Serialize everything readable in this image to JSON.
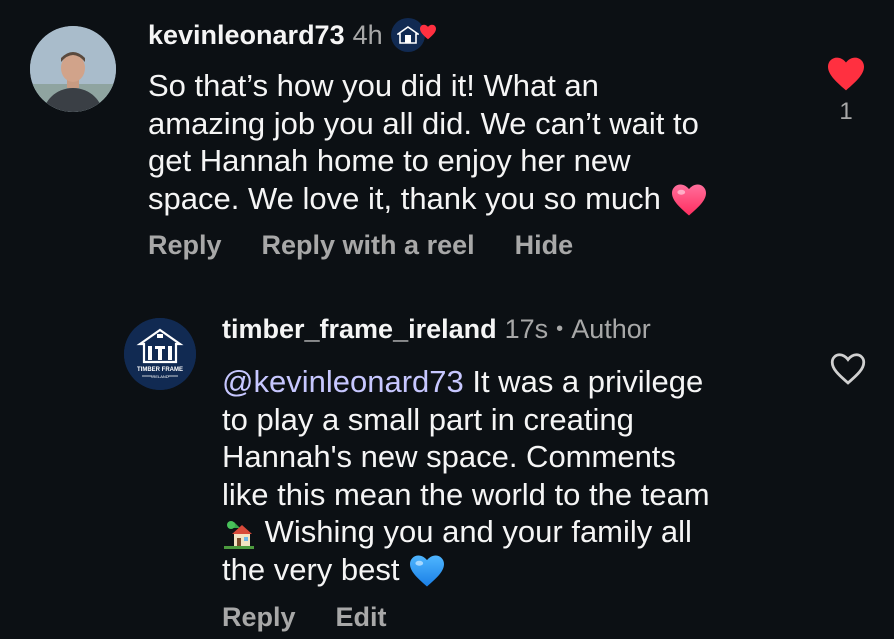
{
  "comment1": {
    "username": "kevinleonard73",
    "time": "4h",
    "text_lines": [
      "So that’s how you did it! What an",
      "amazing job you all did. We can’t wait to",
      "get Hannah home to enjoy her new",
      "space. We love it, thank you so much"
    ],
    "like_count": "1",
    "actions": {
      "reply": "Reply",
      "reply_reel": "Reply with a reel",
      "hide": "Hide"
    },
    "liked": true,
    "like_color": "#ff3040"
  },
  "comment2": {
    "username": "timber_frame_ireland",
    "time": "17s",
    "separator": "•",
    "author_label": "Author",
    "mention": "@kevinleonard73",
    "text_line1_rest": " It was a privilege",
    "text_lines": [
      "to play a small part in creating",
      "Hannah's new space. Comments",
      "like this mean the world to the team"
    ],
    "text_line5": " Wishing you and your family all",
    "text_line6": "the very best",
    "actions": {
      "reply": "Reply",
      "edit": "Edit"
    },
    "liked": false,
    "brand_logo_text": "TIMBER FRAME",
    "brand_logo_sub": "IRELAND",
    "brand_color": "#112a52"
  },
  "icons": {
    "heart_filled": "heart-filled-icon",
    "heart_outline": "heart-outline-icon",
    "pink_heart_emoji": "pink-heart-emoji",
    "blue_heart_emoji": "blue-heart-emoji",
    "house_emoji": "house-emoji"
  },
  "colors": {
    "background": "#0c1014",
    "text": "#f5f5f5",
    "muted": "#a8a8a8",
    "mention": "#c7c7ff",
    "like_red": "#ff3040"
  }
}
